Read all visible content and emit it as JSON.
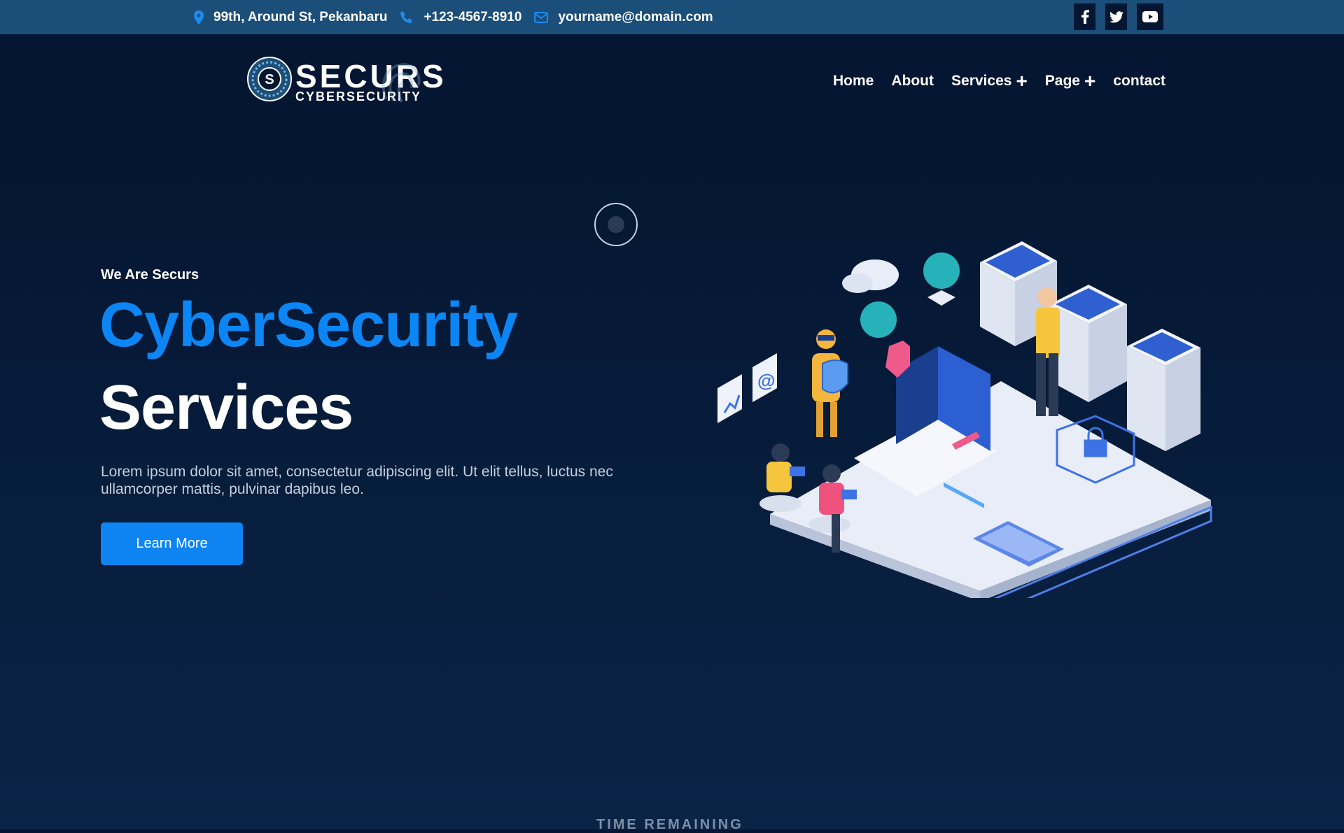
{
  "topbar": {
    "address": "99th, Around St, Pekanbaru",
    "phone": "+123-4567-8910",
    "email": "yourname@domain.com",
    "social": [
      "facebook-icon",
      "twitter-icon",
      "youtube-icon"
    ]
  },
  "logo": {
    "brand": "SECURS",
    "tagline": "CYBERSECURITY"
  },
  "nav": {
    "items": [
      {
        "label": "Home",
        "has_submenu": false
      },
      {
        "label": "About",
        "has_submenu": false
      },
      {
        "label": "Services",
        "has_submenu": true
      },
      {
        "label": "Page",
        "has_submenu": true
      },
      {
        "label": "contact",
        "has_submenu": false
      }
    ]
  },
  "hero": {
    "eyebrow": "We Are Securs",
    "title_line1": "CyberSecurity",
    "title_line2": "Services",
    "description": "Lorem ipsum dolor sit amet, consectetur adipiscing elit. Ut elit tellus, luctus nec ullamcorper mattis, pulvinar dapibus leo.",
    "cta_label": "Learn More"
  },
  "timer": {
    "label": "TIME REMAINING"
  },
  "colors": {
    "topbar_bg": "#1b4e78",
    "page_bg": "#041631",
    "accent": "#0c86f4"
  }
}
